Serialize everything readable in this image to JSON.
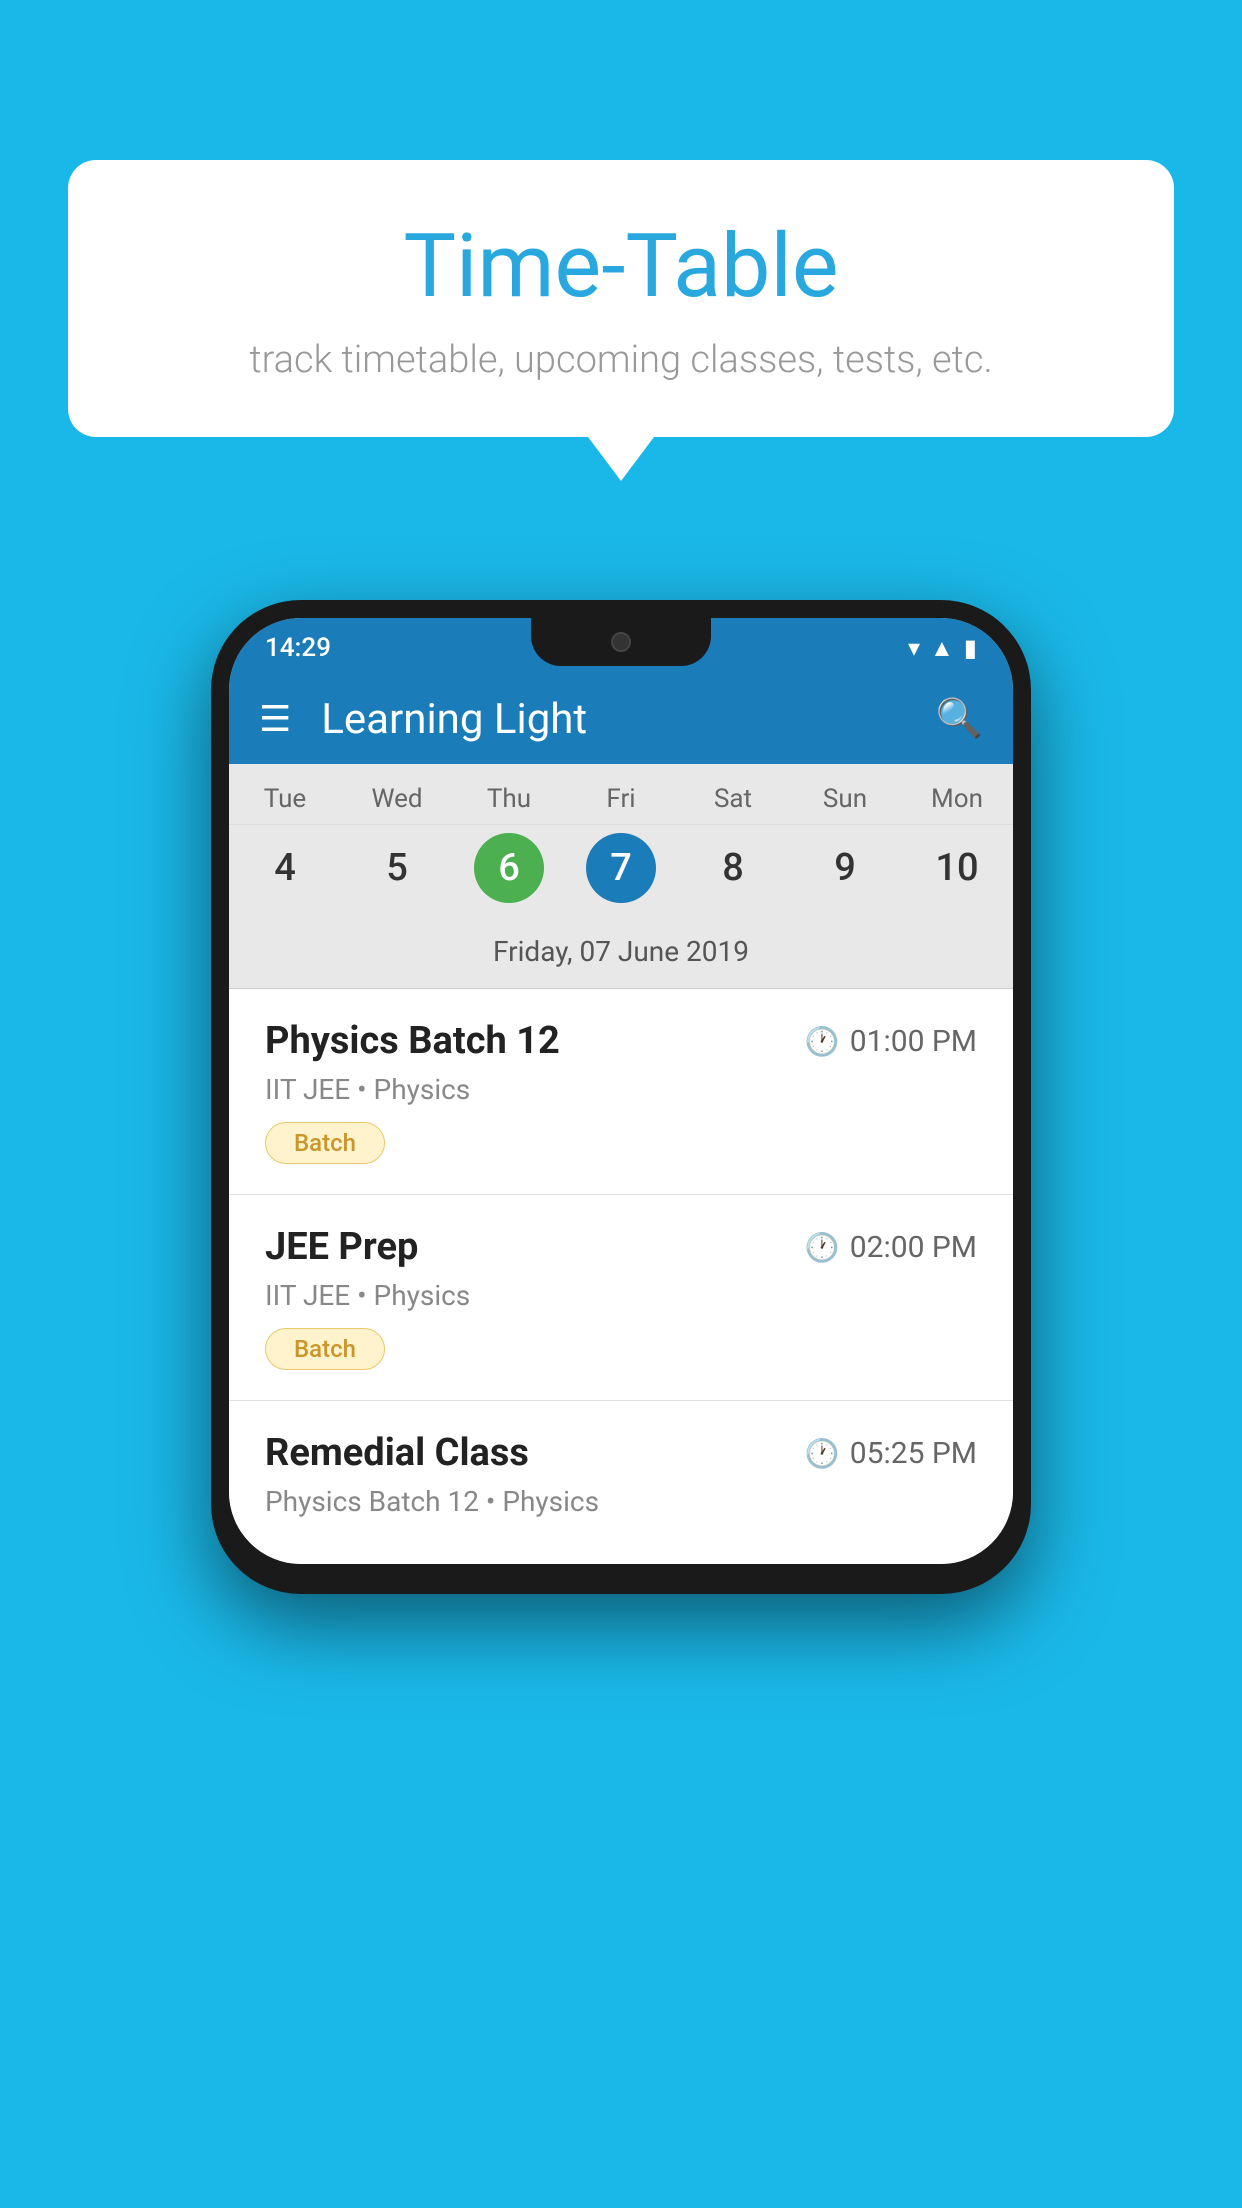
{
  "background_color": "#1ab8e8",
  "speech_bubble": {
    "title": "Time-Table",
    "subtitle": "track timetable, upcoming classes, tests, etc."
  },
  "phone": {
    "status_bar": {
      "time": "14:29"
    },
    "app_bar": {
      "title": "Learning Light",
      "menu_icon": "☰",
      "search_icon": "🔍"
    },
    "calendar": {
      "days": [
        "Tue",
        "Wed",
        "Thu",
        "Fri",
        "Sat",
        "Sun",
        "Mon"
      ],
      "dates": [
        {
          "num": "4",
          "state": "normal"
        },
        {
          "num": "5",
          "state": "normal"
        },
        {
          "num": "6",
          "state": "today"
        },
        {
          "num": "7",
          "state": "selected"
        },
        {
          "num": "8",
          "state": "normal"
        },
        {
          "num": "9",
          "state": "normal"
        },
        {
          "num": "10",
          "state": "normal"
        }
      ],
      "selected_date_text": "Friday, 07 June 2019"
    },
    "schedule": [
      {
        "title": "Physics Batch 12",
        "time": "01:00 PM",
        "subtitle": "IIT JEE • Physics",
        "tag": "Batch"
      },
      {
        "title": "JEE Prep",
        "time": "02:00 PM",
        "subtitle": "IIT JEE • Physics",
        "tag": "Batch"
      },
      {
        "title": "Remedial Class",
        "time": "05:25 PM",
        "subtitle": "Physics Batch 12 • Physics",
        "tag": ""
      }
    ]
  }
}
